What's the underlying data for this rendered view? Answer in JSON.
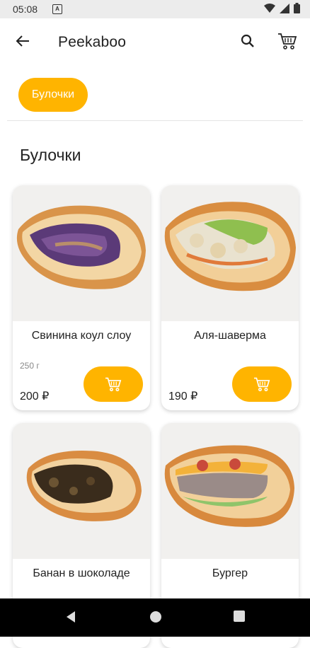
{
  "status": {
    "time": "05:08",
    "notif_icon": "A"
  },
  "header": {
    "title": "Peekaboo"
  },
  "category_chip": {
    "label": "Булочки"
  },
  "section_title": "Булочки",
  "colors": {
    "accent": "#FFB400"
  },
  "products": [
    {
      "name": "Свинина коул слоу",
      "weight": "250 г",
      "price": "200 ₽",
      "filling": "purple"
    },
    {
      "name": "Аля-шаверма",
      "weight": "",
      "price": "190 ₽",
      "filling": "chicken"
    },
    {
      "name": "Банан в шоколаде",
      "weight": "",
      "price": "",
      "filling": "chocolate"
    },
    {
      "name": "Бургер",
      "weight": "",
      "price": "",
      "filling": "burger"
    }
  ]
}
